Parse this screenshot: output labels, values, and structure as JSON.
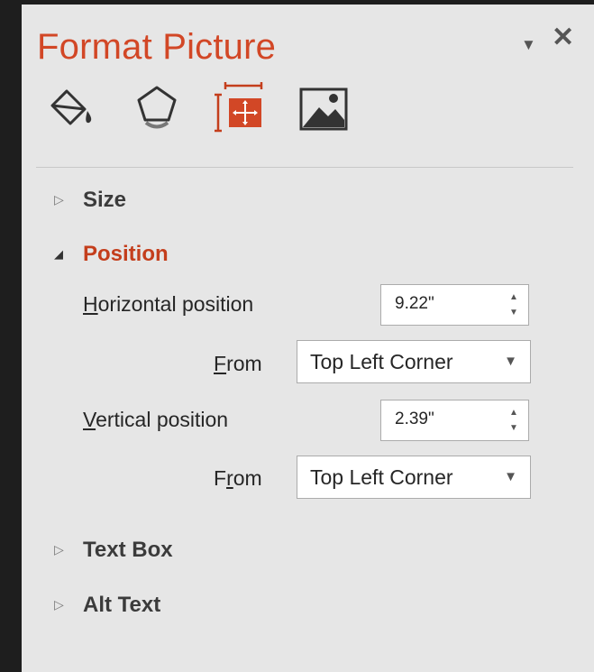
{
  "pane": {
    "title": "Format Picture",
    "menu_icon": "dropdown-arrow-icon",
    "close_icon": "close-icon",
    "accent_color": "#d24726"
  },
  "tabs": [
    {
      "name": "fill-line",
      "icon": "paint-bucket-icon"
    },
    {
      "name": "effects",
      "icon": "pentagon-icon"
    },
    {
      "name": "size-properties",
      "icon": "size-position-icon",
      "selected": true
    },
    {
      "name": "picture",
      "icon": "picture-icon"
    }
  ],
  "sections": {
    "size": {
      "label": "Size",
      "expanded": false
    },
    "position": {
      "label": "Position",
      "expanded": true,
      "horizontal_label_first": "H",
      "horizontal_label_rest": "orizontal position",
      "horizontal_value": "9.22\"",
      "from_label_a_first": "F",
      "from_label_a_rest": "rom",
      "horizontal_from": "Top Left Corner",
      "vertical_label_first": "V",
      "vertical_label_rest": "ertical position",
      "vertical_value": "2.39\"",
      "from_label_b_pre": "F",
      "from_label_b_u": "r",
      "from_label_b_post": "om",
      "vertical_from": "Top Left Corner"
    },
    "text_box": {
      "label": "Text Box",
      "expanded": false
    },
    "alt_text": {
      "label": "Alt Text",
      "expanded": false
    }
  }
}
